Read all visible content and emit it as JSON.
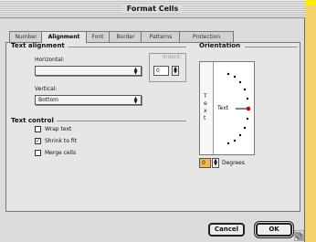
{
  "window": {
    "title": "Format Cells"
  },
  "tabs": [
    {
      "label": "Number",
      "active": false
    },
    {
      "label": "Alignment",
      "active": true
    },
    {
      "label": "Font",
      "active": false
    },
    {
      "label": "Border",
      "active": false
    },
    {
      "label": "Patterns",
      "active": false
    },
    {
      "label": "Protection",
      "active": false
    }
  ],
  "text_alignment": {
    "title": "Text alignment",
    "horizontal_label": "Horizontal:",
    "horizontal_value": "",
    "indent_label": "Indent:",
    "indent_value": "0",
    "vertical_label": "Vertical:",
    "vertical_value": "Bottom"
  },
  "text_control": {
    "title": "Text control",
    "options": [
      {
        "label": "Wrap text",
        "checked": false
      },
      {
        "label": "Shrink to fit",
        "checked": true
      },
      {
        "label": "Merge cells",
        "checked": false
      }
    ]
  },
  "orientation": {
    "title": "Orientation",
    "vertical_letters": [
      "T",
      "e",
      "x",
      "t"
    ],
    "sample_label": "Text",
    "degrees_value": "0",
    "degrees_label": "Degrees",
    "angle_degrees": 0
  },
  "buttons": {
    "cancel": "Cancel",
    "ok": "OK"
  },
  "colors": {
    "background": "#f6d36a",
    "window": "#dcdcdc",
    "panel": "#e6e6e6",
    "indicator": "#cc0000",
    "degree_field": "#f5b84a"
  }
}
